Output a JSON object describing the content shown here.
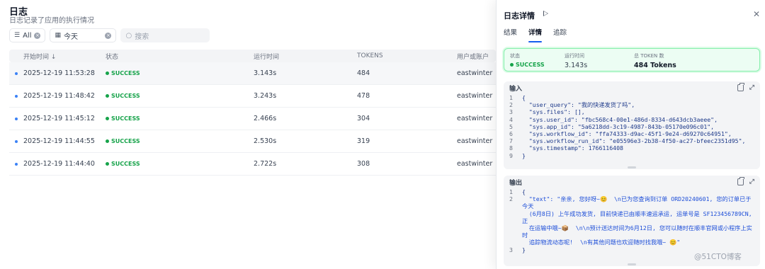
{
  "page": {
    "title": "日志",
    "subtitle": "日志记录了应用的执行情况"
  },
  "filters": {
    "status_label": "All",
    "date_label": "今天",
    "search_placeholder": "搜索"
  },
  "table": {
    "columns": [
      "开始时间 ↓",
      "状态",
      "运行时间",
      "TOKENS",
      "用户或账户"
    ],
    "rows": [
      {
        "time": "2025-12-19 11:53:28",
        "status": "SUCCESS",
        "duration": "3.143s",
        "tokens": "484",
        "user": "eastwinter"
      },
      {
        "time": "2025-12-19 11:48:42",
        "status": "SUCCESS",
        "duration": "3.243s",
        "tokens": "478",
        "user": "eastwinter"
      },
      {
        "time": "2025-12-19 11:45:12",
        "status": "SUCCESS",
        "duration": "2.466s",
        "tokens": "304",
        "user": "eastwinter"
      },
      {
        "time": "2025-12-19 11:44:55",
        "status": "SUCCESS",
        "duration": "2.530s",
        "tokens": "319",
        "user": "eastwinter"
      },
      {
        "time": "2025-12-19 11:44:40",
        "status": "SUCCESS",
        "duration": "2.722s",
        "tokens": "308",
        "user": "eastwinter"
      }
    ]
  },
  "detail": {
    "title": "日志详情",
    "tabs": [
      "结果",
      "详情",
      "追踪"
    ],
    "active_tab": "详情",
    "summary": {
      "status_label": "状态",
      "status_value": "SUCCESS",
      "runtime_label": "运行时间",
      "runtime_value": "3.143s",
      "tokens_label": "总 TOKEN 数",
      "tokens_value": "484 Tokens"
    },
    "input": {
      "label": "输入",
      "lines": [
        {
          "n": "1",
          "text": "{"
        },
        {
          "n": "2",
          "text": "  \"user_query\": \"我的快递发货了吗\","
        },
        {
          "n": "3",
          "text": "  \"sys.files\": [],"
        },
        {
          "n": "4",
          "text": "  \"sys.user_id\": \"fbc568c4-00e1-486d-8334-d643dcb3aeee\","
        },
        {
          "n": "5",
          "text": "  \"sys.app_id\": \"5a6218dd-3c19-4987-843b-05170e096c01\","
        },
        {
          "n": "6",
          "text": "  \"sys.workflow_id\": \"ffa74333-d9ac-45f1-9e24-d69270c64951\","
        },
        {
          "n": "7",
          "text": "  \"sys.workflow_run_id\": \"e05596e3-2b38-4f50-ac27-bfeec2351d95\","
        },
        {
          "n": "8",
          "text": "  \"sys.timestamp\": 1766116408"
        },
        {
          "n": "9",
          "text": "}"
        }
      ]
    },
    "output": {
      "label": "输出",
      "lines": [
        {
          "n": "1",
          "text": "{"
        },
        {
          "n": "2",
          "text": "  \"text\": \"亲亲, 您好呀~😊  \\n已为您查询到订单 ORD20240601, 您的订单已于今天\n  (6月8日) 上午成功发货, 目前快递已由顺丰速运承运, 运单号是 SF123456789CN, 正\n  在运输中哦~📦  \\n\\n预计送达时间为6月12日, 您可以随时在顺丰官网或小程序上实时\n  追踪物流动态呢!  \\n有其他问题也欢迎随时找我哦~ 😊\""
        },
        {
          "n": "3",
          "text": "}"
        }
      ]
    }
  },
  "watermark": "@51CTO博客",
  "colors": {
    "accent": "#155eef",
    "success": "#16a34a",
    "success_bg": "#ecfdf3"
  }
}
